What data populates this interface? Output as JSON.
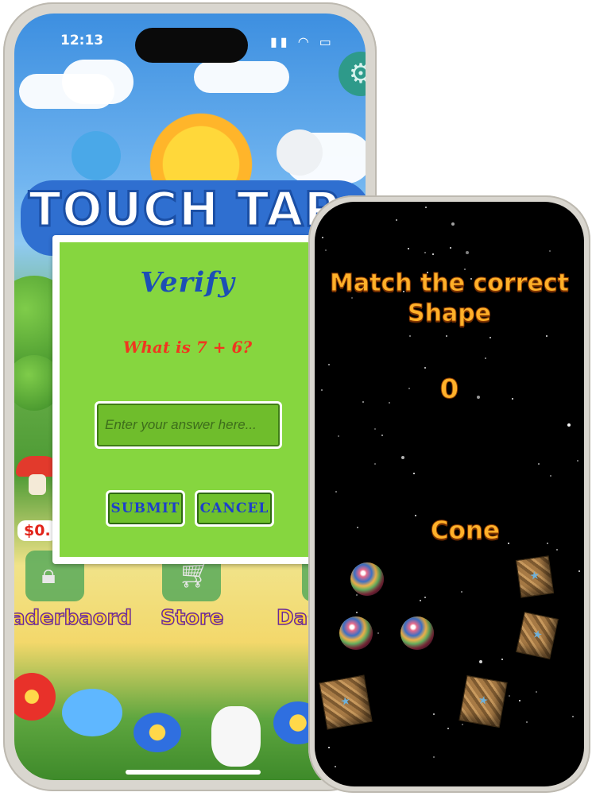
{
  "status_bar": {
    "time": "12:13",
    "icons": "▮▮ ◠ ▭"
  },
  "home_screen": {
    "logo_text": "TOUCH TAP",
    "price_badge": "$0.",
    "menu": [
      {
        "label": "aderbaord",
        "icon": "lock-icon"
      },
      {
        "label": "Store",
        "icon": "cart-icon"
      },
      {
        "label": "Das",
        "icon": ""
      }
    ],
    "settings_icon": "gear-icon"
  },
  "verify_dialog": {
    "title": "Verify",
    "question": "What is 7 + 6?",
    "answer_placeholder": "Enter your answer here...",
    "answer_value": "",
    "submit_label": "SUBMIT",
    "cancel_label": "CANCEL"
  },
  "shape_game": {
    "title_line1": "Match the correct",
    "title_line2": "Shape",
    "score": "0",
    "target_shape": "Cone",
    "shapes": [
      "sphere",
      "cube",
      "sphere",
      "sphere",
      "cube",
      "cube",
      "cube"
    ]
  },
  "colors": {
    "dialog_green": "#86d63f",
    "title_blue": "#1c4fb5",
    "question_red": "#f0361f",
    "game_orange": "#ffb12a"
  }
}
